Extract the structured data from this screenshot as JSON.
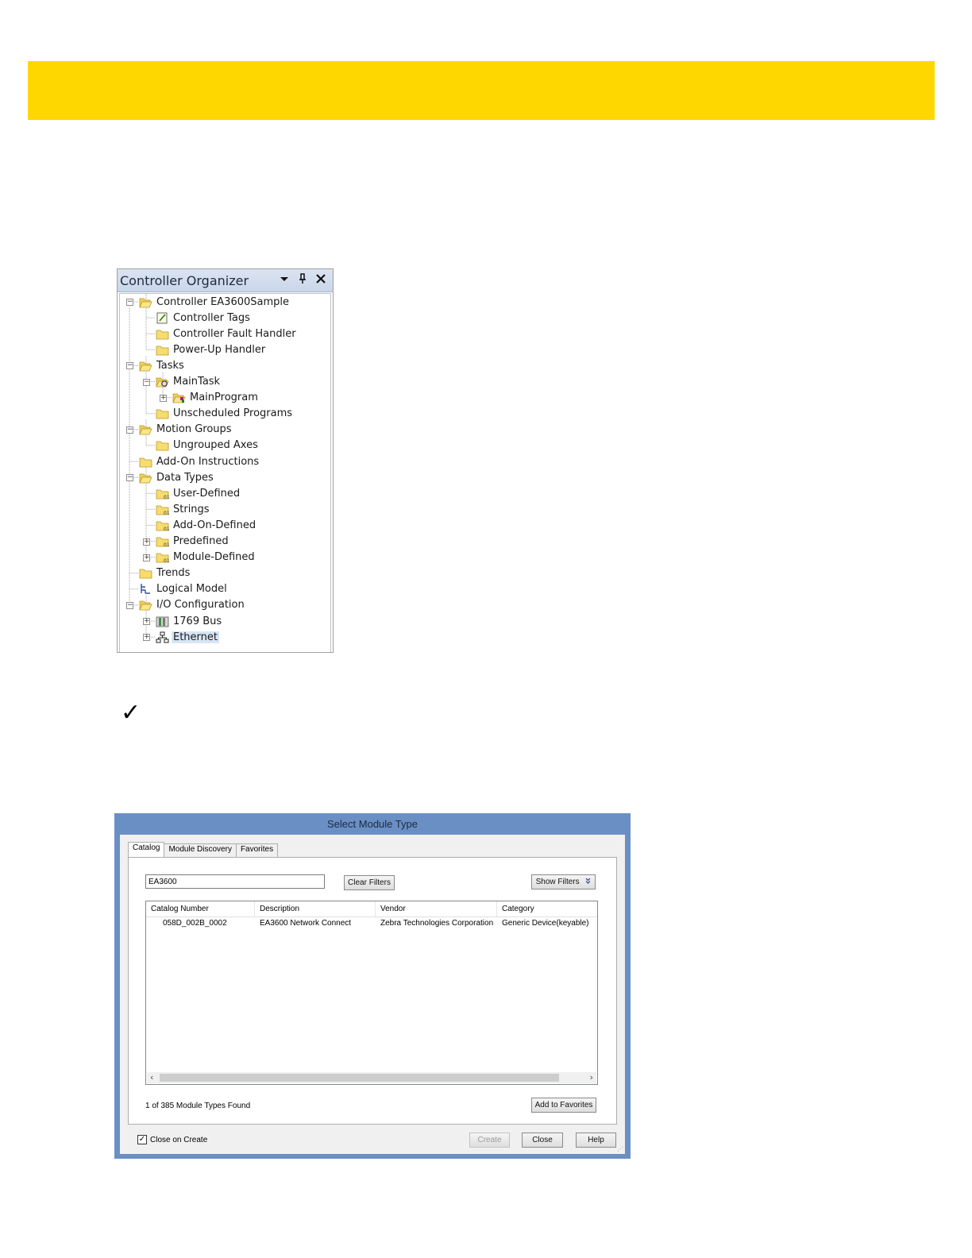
{
  "organizer": {
    "title": "Controller Organizer",
    "icons": {
      "dropdown": "chevron-down-icon",
      "pin": "pin-icon",
      "close": "close-icon"
    },
    "nodes": [
      {
        "label": "Controller EA3600Sample",
        "icon": "folder-open-icon"
      },
      {
        "label": "Controller Tags",
        "icon": "tags-icon"
      },
      {
        "label": "Controller Fault Handler",
        "icon": "folder-icon"
      },
      {
        "label": "Power-Up Handler",
        "icon": "folder-icon"
      },
      {
        "label": "Tasks",
        "icon": "folder-open-icon"
      },
      {
        "label": "MainTask",
        "icon": "task-icon"
      },
      {
        "label": "MainProgram",
        "icon": "program-icon"
      },
      {
        "label": "Unscheduled Programs",
        "icon": "folder-icon"
      },
      {
        "label": "Motion Groups",
        "icon": "folder-open-icon"
      },
      {
        "label": "Ungrouped Axes",
        "icon": "folder-icon"
      },
      {
        "label": "Add-On Instructions",
        "icon": "folder-icon"
      },
      {
        "label": "Data Types",
        "icon": "folder-open-icon"
      },
      {
        "label": "User-Defined",
        "icon": "datatype-folder-icon"
      },
      {
        "label": "Strings",
        "icon": "datatype-folder-icon"
      },
      {
        "label": "Add-On-Defined",
        "icon": "datatype-folder-icon"
      },
      {
        "label": "Predefined",
        "icon": "datatype-folder-icon"
      },
      {
        "label": "Module-Defined",
        "icon": "datatype-folder-icon"
      },
      {
        "label": "Trends",
        "icon": "folder-icon"
      },
      {
        "label": "Logical Model",
        "icon": "logical-model-icon"
      },
      {
        "label": "I/O Configuration",
        "icon": "folder-open-icon"
      },
      {
        "label": "1769 Bus",
        "icon": "bus-icon"
      },
      {
        "label": "Ethernet",
        "icon": "network-icon"
      }
    ]
  },
  "note_icon": "checkmark-icon",
  "note_glyph": "✓",
  "dialog": {
    "title": "Select Module Type",
    "tabs": [
      "Catalog",
      "Module Discovery",
      "Favorites"
    ],
    "search_value": "EA3600",
    "clear_filters": "Clear Filters",
    "show_filters": "Show Filters",
    "show_filters_icon": "double-chevron-down-icon",
    "columns": [
      "Catalog Number",
      "Description",
      "Vendor",
      "Category"
    ],
    "rows": [
      [
        "058D_002B_0002",
        "EA3600 Network Connect",
        "Zebra Technologies Corporation",
        "Generic Device(keyable)"
      ]
    ],
    "found_text": "1 of 385 Module Types Found",
    "add_to_favorites": "Add to Favorites",
    "close_on_create": "Close on Create",
    "close_on_create_checked": true,
    "buttons": {
      "create": "Create",
      "close": "Close",
      "help": "Help"
    }
  }
}
